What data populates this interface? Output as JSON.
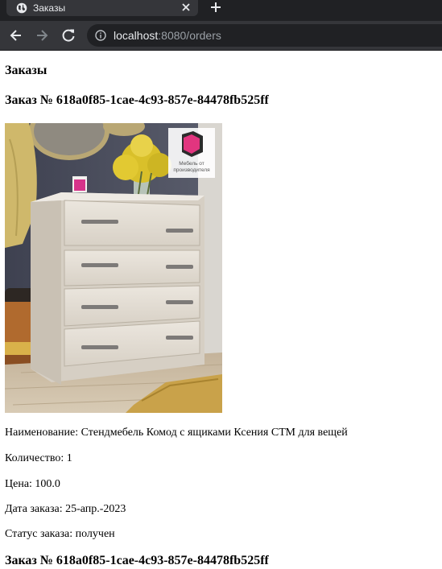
{
  "browser": {
    "tab_title": "Заказы",
    "url_host": "localhost",
    "url_rest": ":8080/orders"
  },
  "page": {
    "heading": "Заказы",
    "orders": [
      {
        "title": "Заказ № 618a0f85-1cae-4c93-857e-84478fb525ff",
        "image_watermark": "Мебель от производителя",
        "name": "Наименование: Стендмебель Комод с ящиками Ксения СТМ для вещей",
        "quantity": "Количество: 1",
        "price": "Цена: 100.0",
        "date": "Дата заказа: 25-апр.-2023",
        "status": "Статус заказа: получен"
      },
      {
        "title": "Заказ № 618a0f85-1cae-4c93-857e-84478fb525ff"
      }
    ]
  }
}
